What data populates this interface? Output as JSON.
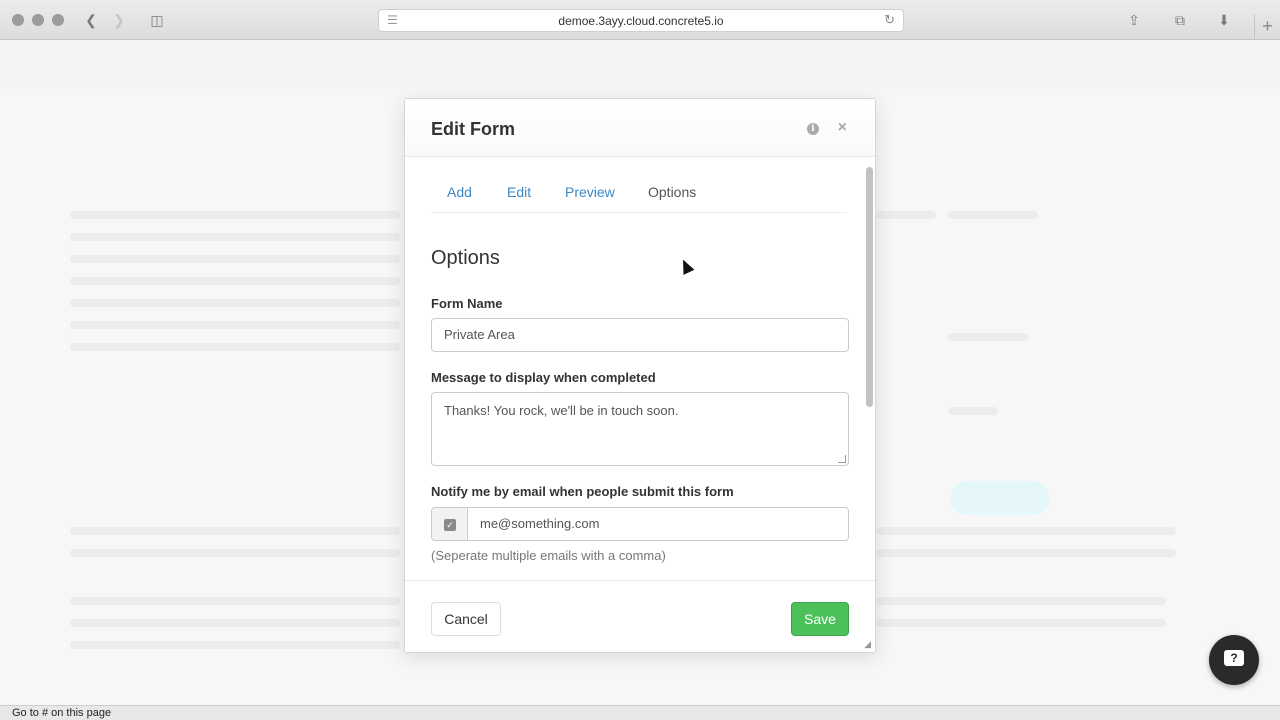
{
  "browser": {
    "url": "demoe.3ayy.cloud.concrete5.io",
    "status_text": "Go to # on this page"
  },
  "modal": {
    "title": "Edit Form",
    "tabs": [
      {
        "label": "Add",
        "active": false
      },
      {
        "label": "Edit",
        "active": false
      },
      {
        "label": "Preview",
        "active": false
      },
      {
        "label": "Options",
        "active": true
      }
    ],
    "section_title": "Options",
    "form_name": {
      "label": "Form Name",
      "value": "Private Area"
    },
    "completion_message": {
      "label": "Message to display when completed",
      "value": "Thanks! You rock, we'll be in touch soon."
    },
    "notify": {
      "label": "Notify me by email when people submit this form",
      "checked": true,
      "email_value": "me@something.com",
      "help": "(Seperate multiple emails with a comma)"
    },
    "footer": {
      "cancel_label": "Cancel",
      "save_label": "Save"
    }
  },
  "colors": {
    "link": "#3b88c8",
    "save_button": "#4cc15a"
  },
  "icons": {
    "info": "info-icon",
    "close": "close-icon",
    "chat": "chat-icon"
  }
}
